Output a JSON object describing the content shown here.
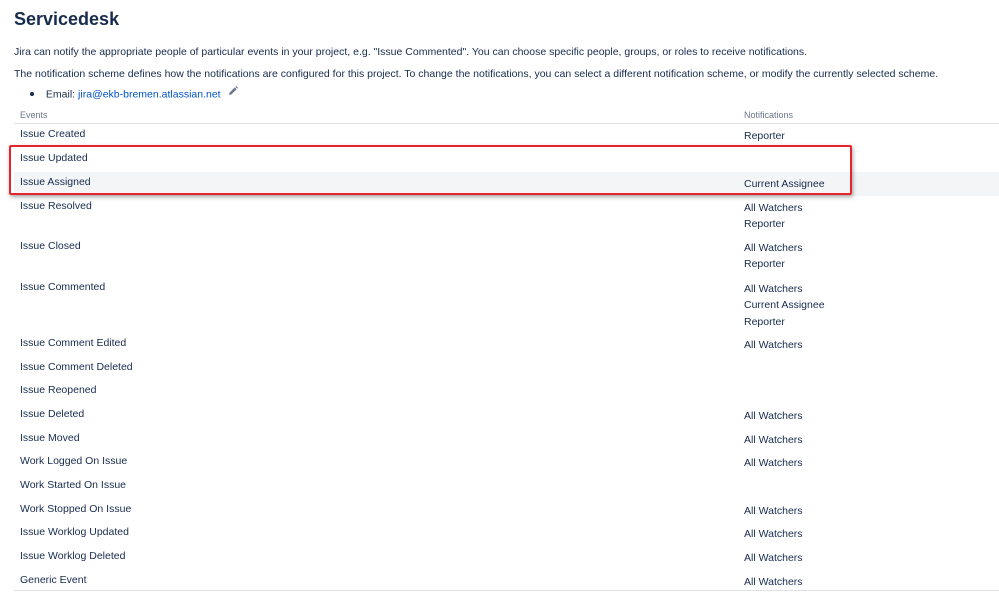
{
  "page": {
    "title": "Servicedesk",
    "intro": "Jira can notify the appropriate people of particular events in your project, e.g. \"Issue Commented\". You can choose specific people, groups, or roles to receive notifications.",
    "scheme_info": "The notification scheme defines how the notifications are configured for this project. To change the notifications, you can select a different notification scheme, or modify the currently selected scheme.",
    "email_label": "Email:",
    "email_value": "jira@ekb-bremen.atlassian.net",
    "edit_icon": "pencil-icon"
  },
  "table": {
    "headers": {
      "events": "Events",
      "notifications": "Notifications"
    },
    "rows": [
      {
        "event": "Issue Created",
        "notifications": [
          "Reporter"
        ]
      },
      {
        "event": "Issue Updated",
        "notifications": []
      },
      {
        "event": "Issue Assigned",
        "notifications": [
          "Current Assignee"
        ]
      },
      {
        "event": "Issue Resolved",
        "notifications": [
          "All Watchers",
          "Reporter"
        ]
      },
      {
        "event": "Issue Closed",
        "notifications": [
          "All Watchers",
          "Reporter"
        ]
      },
      {
        "event": "Issue Commented",
        "notifications": [
          "All Watchers",
          "Current Assignee",
          "Reporter"
        ]
      },
      {
        "event": "Issue Comment Edited",
        "notifications": [
          "All Watchers"
        ]
      },
      {
        "event": "Issue Comment Deleted",
        "notifications": []
      },
      {
        "event": "Issue Reopened",
        "notifications": []
      },
      {
        "event": "Issue Deleted",
        "notifications": [
          "All Watchers"
        ]
      },
      {
        "event": "Issue Moved",
        "notifications": [
          "All Watchers"
        ]
      },
      {
        "event": "Work Logged On Issue",
        "notifications": [
          "All Watchers"
        ]
      },
      {
        "event": "Work Started On Issue",
        "notifications": []
      },
      {
        "event": "Work Stopped On Issue",
        "notifications": [
          "All Watchers"
        ]
      },
      {
        "event": "Issue Worklog Updated",
        "notifications": [
          "All Watchers"
        ]
      },
      {
        "event": "Issue Worklog Deleted",
        "notifications": [
          "All Watchers"
        ]
      },
      {
        "event": "Generic Event",
        "notifications": [
          "All Watchers"
        ]
      }
    ]
  },
  "annotation": {
    "highlight_color": "#e5242b"
  }
}
